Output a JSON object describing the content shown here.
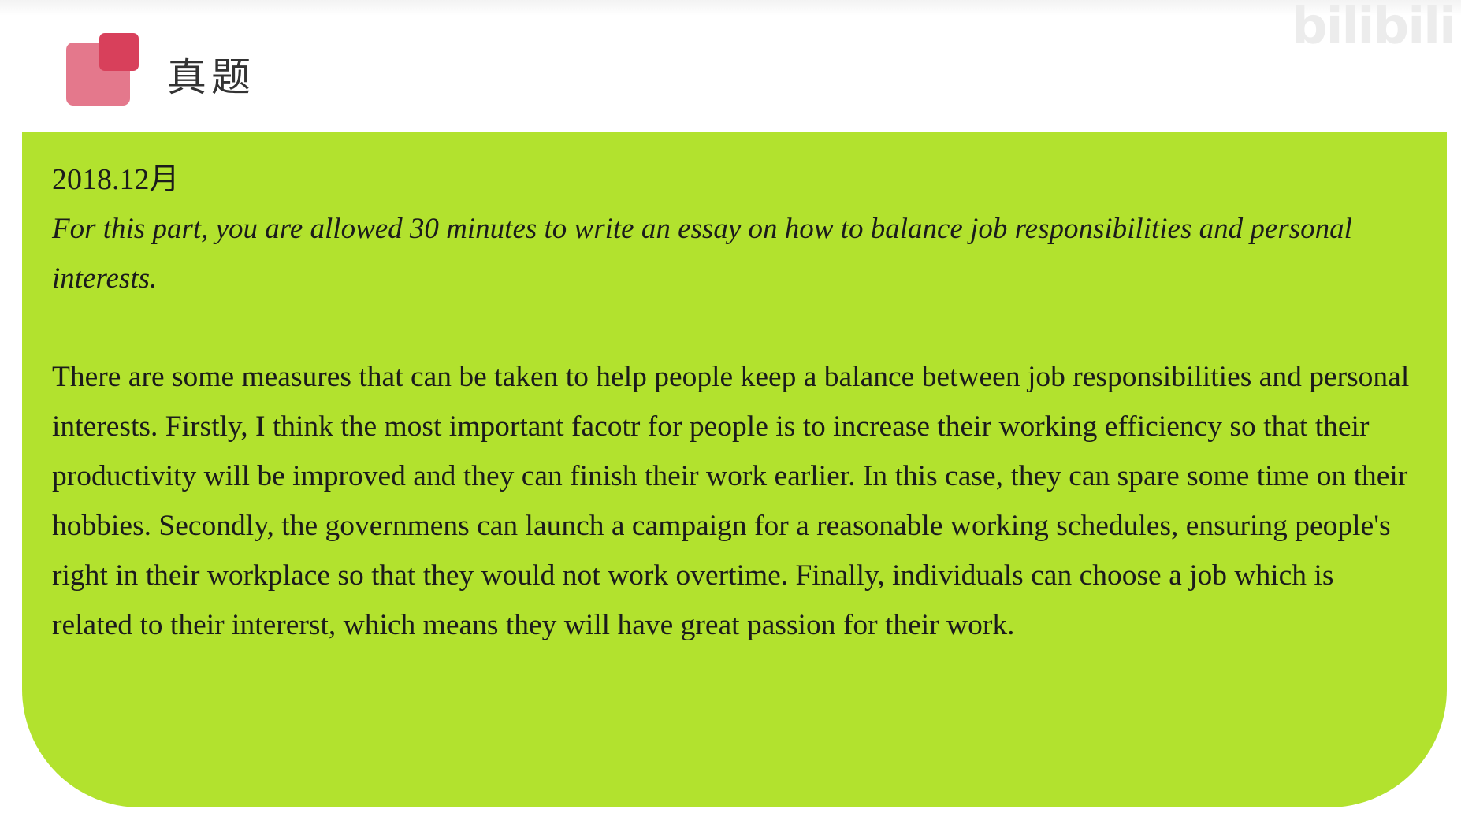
{
  "watermark": "bilibili",
  "header": {
    "title": "真题"
  },
  "content": {
    "date": "2018.12月",
    "prompt": "For this part, you are allowed 30 minutes to write an essay on how to balance job responsibilities and personal interests.",
    "essay": "There are some measures that can be taken to help people keep a balance between job responsibilities and personal interests. Firstly, I think the most important facotr for people is to increase their working efficiency so that their productivity will be improved and they can finish their work earlier. In this case, they can spare some time on their hobbies. Secondly, the governmens can launch a campaign for a reasonable working schedules, ensuring people's right in their workplace so that they would not work overtime. Finally,  individuals can choose a job which is related to their intererst, which means they will have great passion for their work."
  },
  "colors": {
    "panel": "#b2e22e",
    "logo_back": "#e4788c",
    "logo_front": "#d8405b"
  },
  "icons": {
    "logo": "overlapping-squares-icon"
  }
}
